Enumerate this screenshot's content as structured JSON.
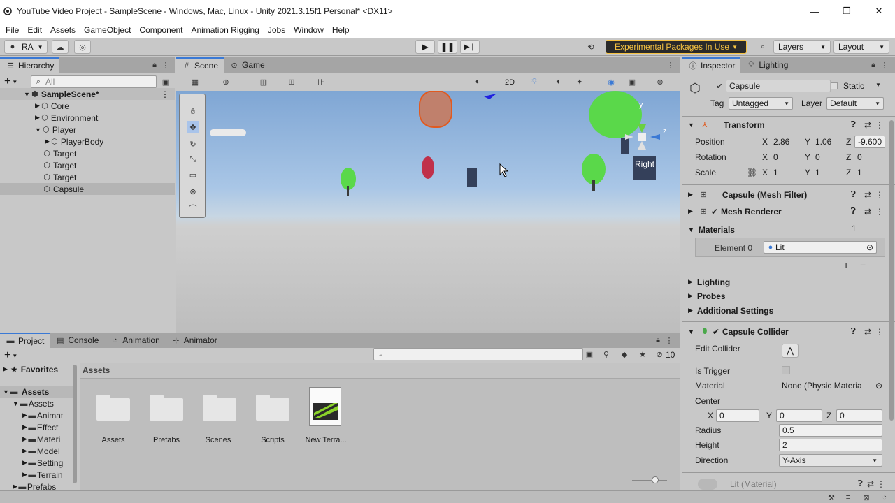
{
  "window": {
    "title": "YouTube Video Project - SampleScene - Windows, Mac, Linux - Unity 2021.3.15f1 Personal* <DX11>",
    "minimize": "—",
    "maximize": "❐",
    "close": "✕"
  },
  "menu": [
    "File",
    "Edit",
    "Assets",
    "GameObject",
    "Component",
    "Animation Rigging",
    "Jobs",
    "Window",
    "Help"
  ],
  "toolbar": {
    "account": "RA",
    "experimental": "Experimental Packages In Use",
    "layers": "Layers",
    "layout": "Layout"
  },
  "hierarchy": {
    "tab": "Hierarchy",
    "search_placeholder": "All",
    "scene": "SampleScene*",
    "items": [
      "Core",
      "Environment",
      "Player",
      "PlayerBody",
      "Target",
      "Target",
      "Target",
      "Capsule"
    ]
  },
  "scene_view": {
    "tabs": [
      "Scene",
      "Game"
    ],
    "mode_2d": "2D",
    "gizmo_label": "Right",
    "gizmo_y": "y",
    "gizmo_z": "z"
  },
  "bottom": {
    "tabs": [
      "Project",
      "Console",
      "Animation",
      "Animator"
    ],
    "hidden_count": "10",
    "favorites": "Favorites",
    "breadcrumb": "Assets",
    "tree": [
      "Assets",
      "Assets",
      "Animat",
      "Effect",
      "Materi",
      "Model",
      "Setting",
      "Terrain",
      "Prefabs"
    ],
    "assets": [
      "Assets",
      "Prefabs",
      "Scenes",
      "Scripts",
      "New Terra..."
    ]
  },
  "inspector": {
    "tabs": [
      "Inspector",
      "Lighting"
    ],
    "object_name": "Capsule",
    "static": "Static",
    "tag_label": "Tag",
    "tag_value": "Untagged",
    "layer_label": "Layer",
    "layer_value": "Default",
    "transform": {
      "title": "Transform",
      "position_label": "Position",
      "rotation_label": "Rotation",
      "scale_label": "Scale",
      "position": {
        "x": "2.86",
        "y": "1.06",
        "z": "-9.600"
      },
      "rotation": {
        "x": "0",
        "y": "0",
        "z": "0"
      },
      "scale": {
        "x": "1",
        "y": "1",
        "z": "1"
      }
    },
    "mesh_filter": "Capsule (Mesh Filter)",
    "mesh_renderer": "Mesh Renderer",
    "materials": {
      "label": "Materials",
      "count": "1",
      "element_label": "Element 0",
      "element_value": "Lit"
    },
    "foldouts": [
      "Lighting",
      "Probes",
      "Additional Settings"
    ],
    "collider": {
      "title": "Capsule Collider",
      "edit_collider": "Edit Collider",
      "is_trigger": "Is Trigger",
      "material_label": "Material",
      "material_value": "None (Physic Materia",
      "center_label": "Center",
      "center": {
        "x": "0",
        "y": "0",
        "z": "0"
      },
      "radius_label": "Radius",
      "radius": "0.5",
      "height_label": "Height",
      "height": "2",
      "direction_label": "Direction",
      "direction": "Y-Axis"
    },
    "lit_material": "Lit (Material)"
  },
  "colors": {
    "accent_blue": "#3a79d5",
    "warning_yellow": "#f5c242",
    "scene_sky": "#9fc2e6"
  }
}
